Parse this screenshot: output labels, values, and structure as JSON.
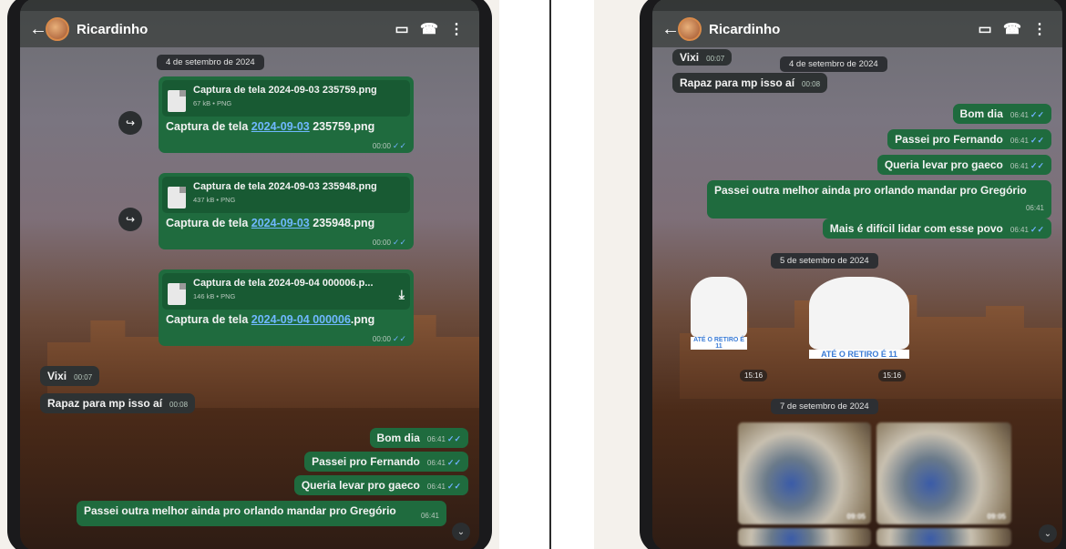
{
  "left": {
    "contact_name": "Ricardinho",
    "date_pill": "4 de setembro de 2024",
    "files": [
      {
        "file_name": "Captura de tela 2024-09-03 235759.png",
        "meta": "67 kB • PNG",
        "caption_prefix": "Captura de tela ",
        "caption_link": "2024-09-03",
        "caption_suffix": " 235759.png",
        "time": "00:00"
      },
      {
        "file_name": "Captura de tela 2024-09-03 235948.png",
        "meta": "437 kB • PNG",
        "caption_prefix": "Captura de tela ",
        "caption_link": "2024-09-03",
        "caption_suffix": " 235948.png",
        "time": "00:00"
      },
      {
        "file_name": "Captura de tela 2024-09-04 000006.p...",
        "meta": "146 kB • PNG",
        "caption_prefix": "Captura de tela ",
        "caption_link": "2024-09-04 000006",
        "caption_suffix": ".png",
        "time": "00:00"
      }
    ],
    "incoming": [
      {
        "text": "Vixi",
        "time": "00:07"
      },
      {
        "text": "Rapaz para mp isso aí",
        "time": "00:08"
      }
    ],
    "outgoing": [
      {
        "text": "Bom dia",
        "time": "06:41"
      },
      {
        "text": "Passei pro Fernando",
        "time": "06:41"
      },
      {
        "text": "Queria levar pro gaeco",
        "time": "06:41"
      },
      {
        "text": "Passei outra melhor ainda pro orlando mandar pro Gregório",
        "time": "06:41"
      }
    ]
  },
  "right": {
    "contact_name": "Ricardinho",
    "incoming": [
      {
        "text": "Vixi",
        "time": "00:07"
      },
      {
        "text": "Rapaz para mp isso aí",
        "time": "00:08"
      }
    ],
    "date_pill_1": "4 de setembro de 2024",
    "outgoing": [
      {
        "text": "Bom dia",
        "time": "06:41"
      },
      {
        "text": "Passei pro Fernando",
        "time": "06:41"
      },
      {
        "text": "Queria levar pro gaeco",
        "time": "06:41"
      },
      {
        "text": "Passei outra melhor ainda pro orlando mandar pro Gregório",
        "time": "06:41"
      },
      {
        "text": "Mais é difícil lidar com esse povo",
        "time": "06:41"
      }
    ],
    "date_pill_2": "5 de setembro de 2024",
    "stickers": [
      {
        "caption": "ATÉ O RETIRO É 11",
        "time": "15:16"
      },
      {
        "caption": "ATÉ O RETIRO É 11",
        "time": "15:16"
      }
    ],
    "date_pill_3": "7 de setembro de 2024",
    "media_times": [
      "09:05",
      "09:05"
    ]
  },
  "icons": {
    "back": "←",
    "video": "▭",
    "call": "☎",
    "menu": "⋮",
    "forward": "↪",
    "download": "⤓",
    "scroll_down": "⌄",
    "ticks": "✓✓"
  }
}
